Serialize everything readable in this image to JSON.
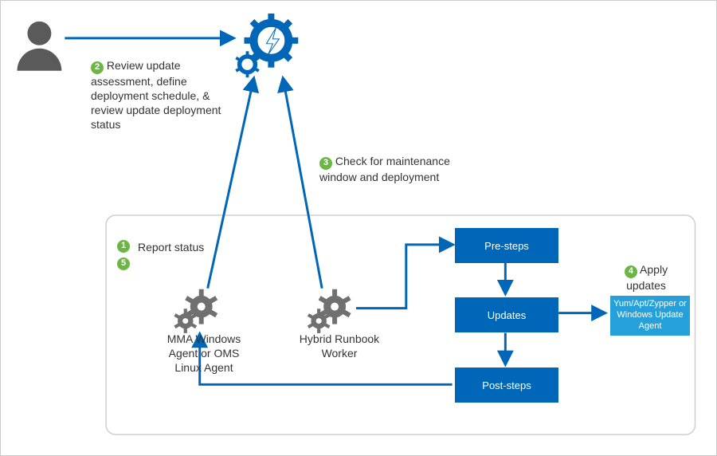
{
  "steps": {
    "s1": {
      "num": "1",
      "label": "Report status"
    },
    "s2": {
      "num": "2",
      "label": "Review update assessment, define deployment schedule, & review update deployment status"
    },
    "s3": {
      "num": "3",
      "label": "Check for maintenance window and deployment"
    },
    "s4": {
      "num": "4",
      "label": "Apply updates"
    },
    "s5": {
      "num": "5"
    }
  },
  "nodes": {
    "mma": "MMA Windows Agent or OMS Linux Agent",
    "hybrid": "Hybrid Runbook Worker",
    "pre": "Pre-steps",
    "upd": "Updates",
    "post": "Post-steps",
    "tool": "Yum/Apt/Zypper or Windows Update Agent"
  }
}
